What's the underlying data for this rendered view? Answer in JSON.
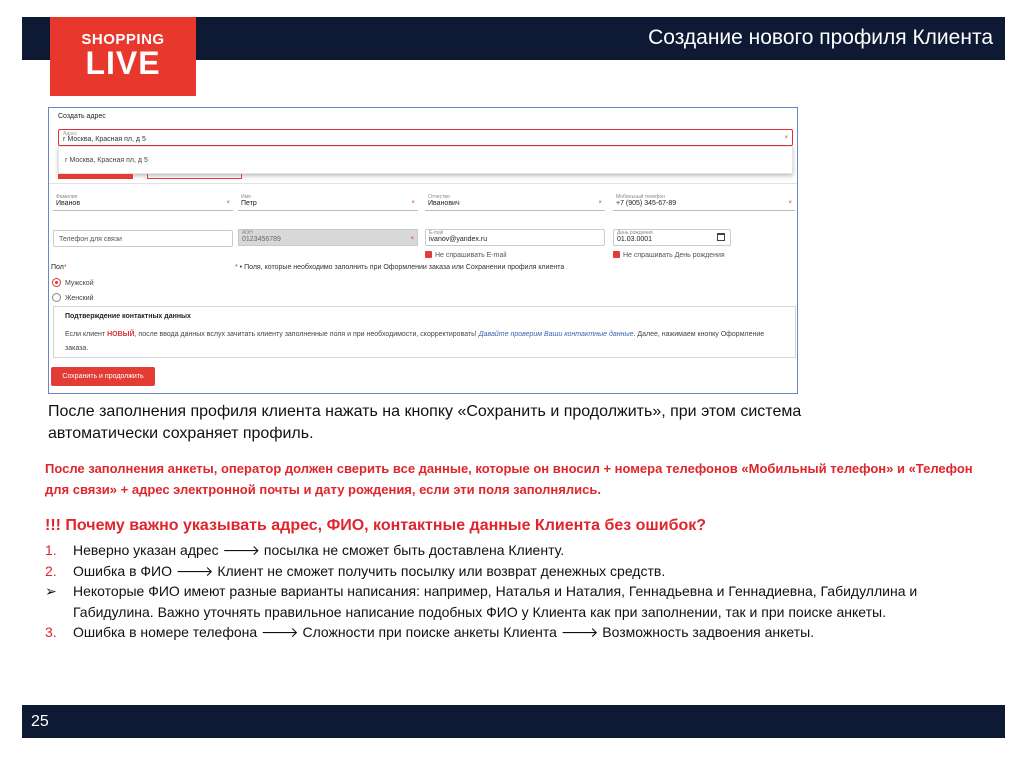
{
  "header": {
    "title": "Создание нового профиля Клиента",
    "logo_line1": "SHOPPING",
    "logo_line2": "LIVE"
  },
  "form": {
    "address_block_title": "Создать адрес",
    "address_label": "Адрес",
    "address_value": "г Москва, Красная пл, д 5",
    "address_suggestion": "г Москва, Красная пл, д 5",
    "clear_symbol": "×",
    "fields": {
      "surname": {
        "label": "Фамилия",
        "value": "Иванов"
      },
      "name": {
        "label": "Имя",
        "value": "Петр"
      },
      "patronymic": {
        "label": "Отчество",
        "value": "Иванович"
      },
      "mobile": {
        "label": "Мобильный телефон",
        "value": "+7 (905) 345-67-89"
      },
      "contact_phone": {
        "placeholder": "Телефон для связи"
      },
      "aon": {
        "label": "АОН",
        "value": "0123456789"
      },
      "email": {
        "label": "E-mail",
        "value": "ivanov@yandex.ru"
      },
      "birthday": {
        "label": "День рождения",
        "value": "01.03.0001"
      }
    },
    "dont_ask_email": "Не спрашивать E-mail",
    "dont_ask_birthday": "Не спрашивать День рождения",
    "gender": {
      "title": "Пол",
      "required_mark": "*",
      "options": [
        "Мужской",
        "Женский"
      ],
      "selected": "Мужской"
    },
    "required_note": "Поля, которые необходимо заполнить при Оформлении заказа или Сохранении профиля клиента",
    "required_note_mark": "*",
    "confirm": {
      "title": "Подтверждение контактных данных",
      "text_before": "Если клиент ",
      "text_new": "НОВЫЙ",
      "text_mid": ", после ввода данных вслух зачитать клиенту заполненные поля и при необходимости, скорректировать! ",
      "text_link": "Давайте проверим Ваши контактные данные",
      "text_after": ". Далее, нажимаем кнопку Оформление заказа."
    },
    "save_button": "Сохранить и продолжить"
  },
  "body": {
    "paragraph": "После заполнения профиля клиента нажать на кнопку «Сохранить и продолжить», при этом система автоматически сохраняет профиль.",
    "warning": "После заполнения анкеты, оператор должен сверить все данные, которые он вносил + номера телефонов «Мобильный телефон» и «Телефон для связи» + адрес электронной почты и дату рождения, если эти поля заполнялись.",
    "question": "!!! Почему важно указывать адрес, ФИО, контактные данные Клиента без ошибок?",
    "items": [
      {
        "marker": "1.",
        "text": "Неверно указан адрес 🡒 посылка не сможет быть доставлена Клиенту."
      },
      {
        "marker": "2.",
        "text": "Ошибка в ФИО 🡒 Клиент не сможет получить посылку или возврат денежных средств."
      },
      {
        "marker": "➢",
        "text": "Некоторые ФИО имеют разные варианты написания: например, Наталья и Наталия, Геннадьевна и Геннадиевна, Габидуллина и Габидулина. Важно уточнять правильное написание подобных ФИО у Клиента как при заполнении, так и при поиске анкеты."
      },
      {
        "marker": "3.",
        "text": "Ошибка в номере телефона 🡒 Сложности при поиске анкеты Клиента 🡒 Возможность задвоения анкеты."
      }
    ]
  },
  "footer": {
    "page_number": "25"
  },
  "colors": {
    "navy": "#0e1a33",
    "brand_red": "#e8372c",
    "alert_red": "#e0252c"
  }
}
